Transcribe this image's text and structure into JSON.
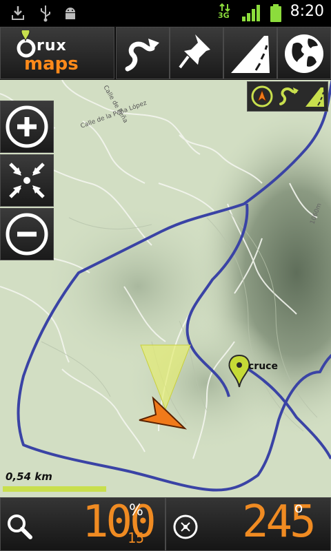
{
  "status_bar": {
    "network_label": "3G",
    "time": "8:20",
    "icons": [
      "download-icon",
      "usb-icon",
      "android-debug-icon",
      "network-arrows-icon",
      "signal-bars-icon",
      "battery-icon"
    ]
  },
  "app": {
    "logo_line1": "rux",
    "logo_line2": "maps"
  },
  "toolbar": {
    "icons": [
      "route-icon",
      "waypoint-pin-icon",
      "road-icon",
      "globe-icon"
    ]
  },
  "map": {
    "waypoint_label": "cruce",
    "street_labels": [
      "Calle de la Peña López",
      "Calle de Peña"
    ],
    "contour_label": "1060m",
    "scale_label": "0,54 km"
  },
  "zoom_controls": {
    "icons": [
      "zoom-in-icon",
      "center-icon",
      "zoom-out-icon"
    ]
  },
  "mini_panel": {
    "icons": [
      "compass-small-icon",
      "route-small-icon",
      "road-small-icon"
    ]
  },
  "bottom_bar": {
    "zoom_value": "100",
    "zoom_unit": "%",
    "zoom_sub": "15",
    "heading_value": "245",
    "heading_unit": "o"
  },
  "colors": {
    "track": "#3a43a5",
    "accent_orange": "#f08b22",
    "accent_lime": "#c8df4d"
  }
}
